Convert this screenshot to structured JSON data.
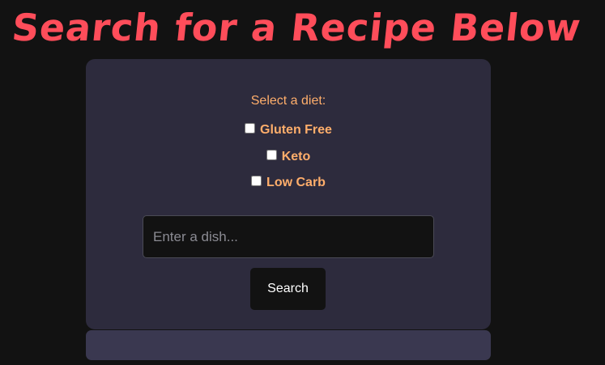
{
  "header": {
    "title": "Search for a Recipe Below"
  },
  "search_form": {
    "diet_label": "Select a diet:",
    "diets": [
      {
        "label": "Gluten Free",
        "checked": false
      },
      {
        "label": "Keto",
        "checked": false
      },
      {
        "label": "Low Carb",
        "checked": false
      }
    ],
    "dish_input": {
      "value": "",
      "placeholder": "Enter a dish..."
    },
    "search_button_label": "Search"
  },
  "results": {},
  "colors": {
    "page_background": "#121212",
    "title": "#ff4d5a",
    "card_background": "#2d2b3d",
    "label_text": "#ffae6b",
    "input_background": "#121212",
    "button_background": "#121212",
    "results_panel_background": "#3a3850"
  }
}
